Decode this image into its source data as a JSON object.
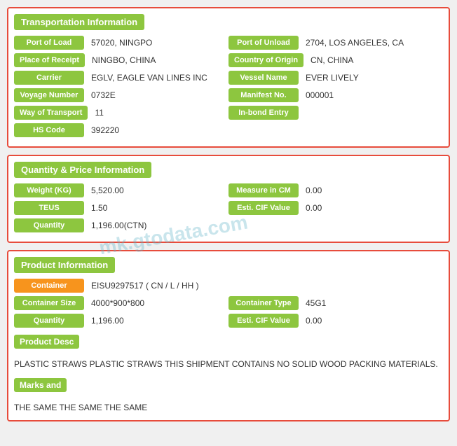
{
  "transportation": {
    "header": "Transportation Information",
    "fields": [
      {
        "left_label": "Port of Load",
        "left_value": "57020, NINGPO",
        "right_label": "Port of Unload",
        "right_value": "2704, LOS ANGELES, CA"
      },
      {
        "left_label": "Place of Receipt",
        "left_value": "NINGBO, CHINA",
        "right_label": "Country of Origin",
        "right_value": "CN, CHINA"
      },
      {
        "left_label": "Carrier",
        "left_value": "EGLV, EAGLE VAN LINES INC",
        "right_label": "Vessel Name",
        "right_value": "EVER LIVELY"
      },
      {
        "left_label": "Voyage Number",
        "left_value": "0732E",
        "right_label": "Manifest No.",
        "right_value": "000001"
      },
      {
        "left_label": "Way of Transport",
        "left_value": "11",
        "right_label": "In-bond Entry",
        "right_value": ""
      },
      {
        "left_label": "HS Code",
        "left_value": "392220",
        "right_label": "",
        "right_value": ""
      }
    ]
  },
  "quantity": {
    "header": "Quantity & Price Information",
    "fields": [
      {
        "left_label": "Weight (KG)",
        "left_value": "5,520.00",
        "right_label": "Measure in CM",
        "right_value": "0.00"
      },
      {
        "left_label": "TEUS",
        "left_value": "1.50",
        "right_label": "Esti. CIF Value",
        "right_value": "0.00"
      },
      {
        "left_label": "Quantity",
        "left_value": "1,196.00(CTN)",
        "right_label": "",
        "right_value": ""
      }
    ]
  },
  "product": {
    "header": "Product Information",
    "container_label": "Container",
    "container_value": "EISU9297517 ( CN / L / HH )",
    "fields": [
      {
        "left_label": "Container Size",
        "left_value": "4000*900*800",
        "right_label": "Container Type",
        "right_value": "45G1"
      },
      {
        "left_label": "Quantity",
        "left_value": "1,196.00",
        "right_label": "Esti. CIF Value",
        "right_value": "0.00"
      }
    ],
    "product_desc_label": "Product Desc",
    "product_desc_value": "PLASTIC STRAWS PLASTIC STRAWS THIS SHIPMENT CONTAINS NO SOLID WOOD PACKING MATERIALS.",
    "marks_label": "Marks and",
    "marks_value": "THE SAME THE SAME THE SAME"
  },
  "watermark": "mk.gtodata.com"
}
